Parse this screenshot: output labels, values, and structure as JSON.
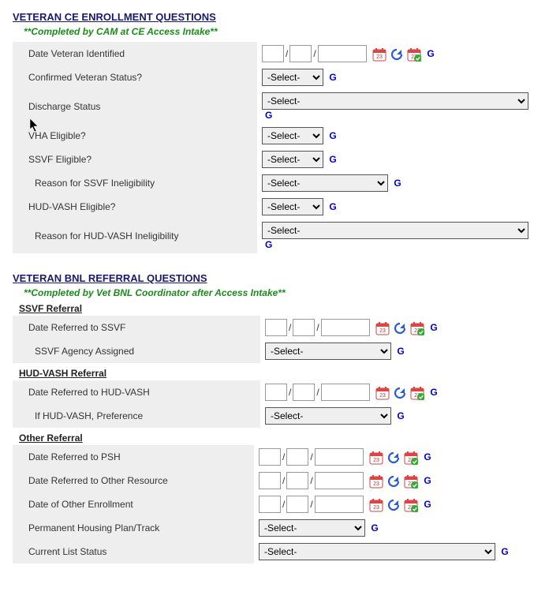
{
  "section1": {
    "title": "VETERAN CE ENROLLMENT QUESTIONS",
    "subtitle": "**Completed by CAM at CE Access Intake**",
    "rows": {
      "date_identified": "Date Veteran Identified",
      "confirmed": "Confirmed Veteran Status?",
      "discharge": "Discharge Status",
      "vha": "VHA Eligible?",
      "ssvf": "SSVF Eligible?",
      "ssvf_reason": "Reason for SSVF Ineligibility",
      "hudvash": "HUD-VASH Eligible?",
      "hudvash_reason": "Reason for HUD-VASH Ineligibility"
    }
  },
  "section2": {
    "title": "VETERAN BNL REFERRAL QUESTIONS",
    "subtitle": "**Completed by Vet BNL Coordinator after Access Intake**",
    "ssvf_ref": {
      "heading": "SSVF Referral",
      "date": "Date Referred to SSVF",
      "agency": "SSVF Agency Assigned"
    },
    "hud_ref": {
      "heading": "HUD-VASH Referral",
      "date": "Date Referred to HUD-VASH",
      "pref": "If HUD-VASH, Preference"
    },
    "other_ref": {
      "heading": "Other Referral",
      "psh": "Date Referred to PSH",
      "other": "Date Referred to Other Resource",
      "enroll": "Date of Other Enrollment",
      "plan": "Permanent Housing Plan/Track",
      "status": "Current List Status"
    }
  },
  "select": {
    "placeholder": "-Select-"
  },
  "g": "G"
}
